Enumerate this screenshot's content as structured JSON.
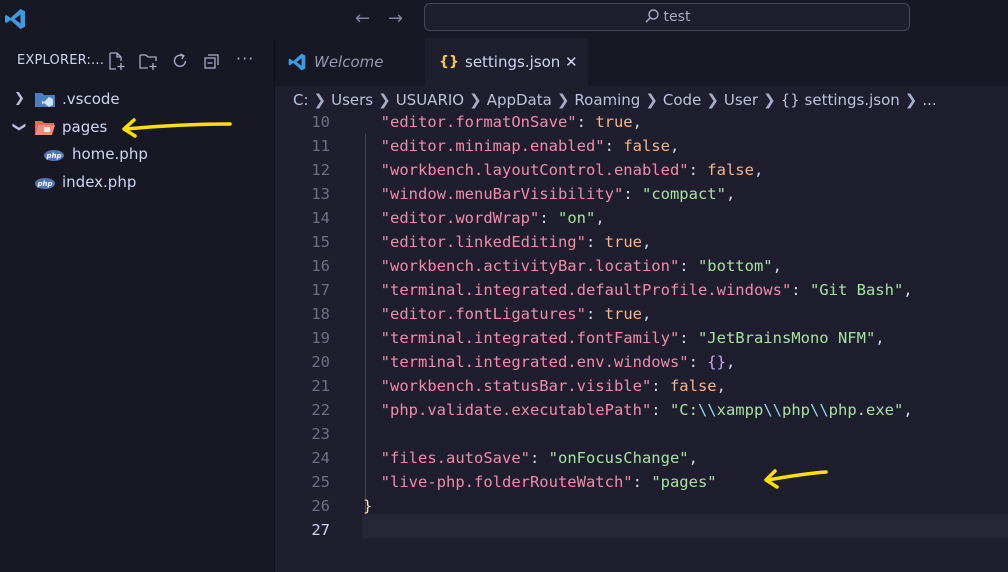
{
  "window": {
    "search_text": "test"
  },
  "explorer": {
    "title": "EXPLORER:...",
    "items": [
      {
        "label": ".vscode",
        "type": "folder",
        "expanded": false
      },
      {
        "label": "pages",
        "type": "folder",
        "expanded": true
      },
      {
        "label": "home.php",
        "type": "file"
      },
      {
        "label": "index.php",
        "type": "file"
      }
    ]
  },
  "tabs": {
    "welcome": "Welcome",
    "active": "settings.json",
    "active_icon": "{}",
    "close": "✕"
  },
  "breadcrumb": [
    "C:",
    "Users",
    "USUARIO",
    "AppData",
    "Roaming",
    "Code",
    "User",
    "{} settings.json",
    "..."
  ],
  "code": {
    "current_line": "27",
    "lines": [
      {
        "n": "10",
        "key": "\"editor.formatOnSave\"",
        "val": "true",
        "tail": ","
      },
      {
        "n": "11",
        "key": "\"editor.minimap.enabled\"",
        "val": "false",
        "tail": ","
      },
      {
        "n": "12",
        "key": "\"workbench.layoutControl.enabled\"",
        "val": "false",
        "tail": ","
      },
      {
        "n": "13",
        "key": "\"window.menuBarVisibility\"",
        "val": "\"compact\"",
        "tail": ","
      },
      {
        "n": "14",
        "key": "\"editor.wordWrap\"",
        "val": "\"on\"",
        "tail": ","
      },
      {
        "n": "15",
        "key": "\"editor.linkedEditing\"",
        "val": "true",
        "tail": ","
      },
      {
        "n": "16",
        "key": "\"workbench.activityBar.location\"",
        "val": "\"bottom\"",
        "tail": ","
      },
      {
        "n": "17",
        "key": "\"terminal.integrated.defaultProfile.windows\"",
        "val": "\"Git Bash\"",
        "tail": ","
      },
      {
        "n": "18",
        "key": "\"editor.fontLigatures\"",
        "val": "true",
        "tail": ","
      },
      {
        "n": "19",
        "key": "\"terminal.integrated.fontFamily\"",
        "val": "\"JetBrainsMono NFM\"",
        "tail": ","
      },
      {
        "n": "20",
        "key": "\"terminal.integrated.env.windows\"",
        "val": "{}",
        "tail": ","
      },
      {
        "n": "21",
        "key": "\"workbench.statusBar.visible\"",
        "val": "false",
        "tail": ","
      },
      {
        "n": "22",
        "key": "\"php.validate.executablePath\"",
        "val": "\"C:\\\\xampp\\\\php\\\\php.exe\"",
        "tail": ","
      },
      {
        "n": "23",
        "key": "",
        "val": "",
        "tail": ""
      },
      {
        "n": "24",
        "key": "\"files.autoSave\"",
        "val": "\"onFocusChange\"",
        "tail": ","
      },
      {
        "n": "25",
        "key": "\"live-php.folderRouteWatch\"",
        "val": "\"pages\"",
        "tail": ""
      },
      {
        "n": "26",
        "key": "",
        "val": "}",
        "tail": ""
      },
      {
        "n": "27",
        "key": "",
        "val": "",
        "tail": ""
      }
    ]
  },
  "colors": {
    "background": "#1e1e2e",
    "sidebar": "#181825",
    "key": "#f38ba8",
    "string": "#a6e3a1",
    "boolean": "#fab387",
    "annotation_arrow": "#ffe000"
  }
}
